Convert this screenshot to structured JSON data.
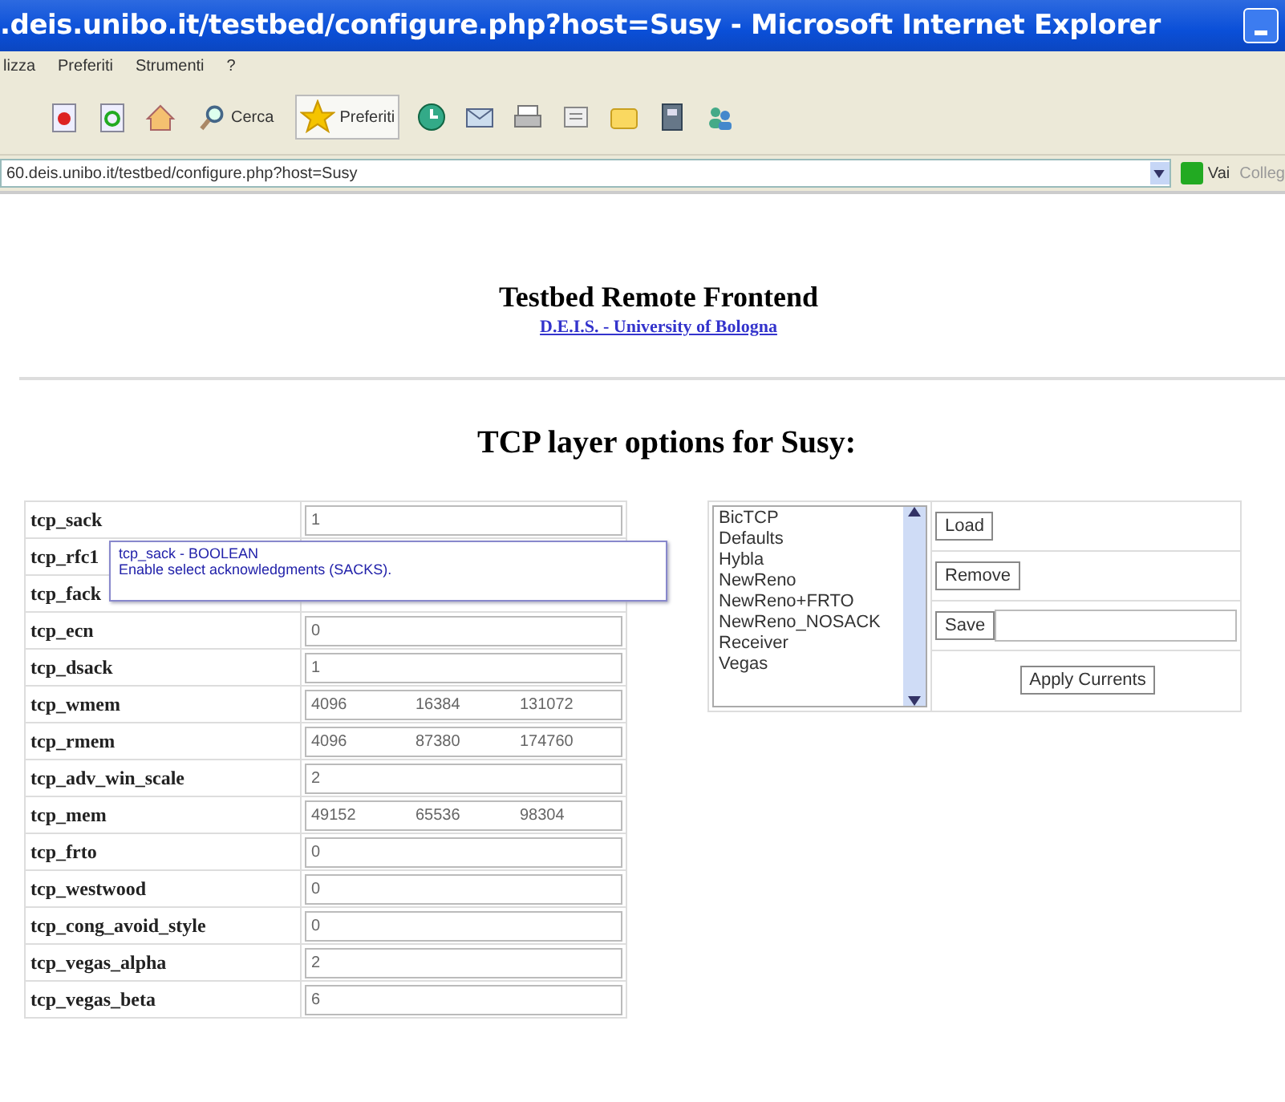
{
  "window": {
    "title": ".deis.unibo.it/testbed/configure.php?host=Susy - Microsoft Internet Explorer"
  },
  "menu": [
    "lizza",
    "Preferiti",
    "Strumenti",
    "?"
  ],
  "toolbar": {
    "search": "Cerca",
    "favorites": "Preferiti"
  },
  "address": {
    "value": "60.deis.unibo.it/testbed/configure.php?host=Susy",
    "go": "Vai",
    "links": "Colleg"
  },
  "page": {
    "heading": "Testbed Remote Frontend",
    "link": "D.E.I.S. - University of Bologna",
    "subheading": "TCP layer options for Susy:"
  },
  "params": [
    {
      "name": "tcp_sack",
      "values": [
        "1"
      ]
    },
    {
      "name": "tcp_rfc1"
    },
    {
      "name": "tcp_fack"
    },
    {
      "name": "tcp_ecn",
      "values": [
        "0"
      ]
    },
    {
      "name": "tcp_dsack",
      "values": [
        "1"
      ]
    },
    {
      "name": "tcp_wmem",
      "values": [
        "4096",
        "16384",
        "131072"
      ]
    },
    {
      "name": "tcp_rmem",
      "values": [
        "4096",
        "87380",
        "174760"
      ]
    },
    {
      "name": "tcp_adv_win_scale",
      "values": [
        "2"
      ]
    },
    {
      "name": "tcp_mem",
      "values": [
        "49152",
        "65536",
        "98304"
      ]
    },
    {
      "name": "tcp_frto",
      "values": [
        "0"
      ]
    },
    {
      "name": "tcp_westwood",
      "values": [
        "0"
      ]
    },
    {
      "name": "tcp_cong_avoid_style",
      "values": [
        "0"
      ]
    },
    {
      "name": "tcp_vegas_alpha",
      "values": [
        "2"
      ]
    },
    {
      "name": "tcp_vegas_beta",
      "values": [
        "6"
      ]
    }
  ],
  "tooltip": {
    "title": "tcp_sack - BOOLEAN",
    "text": "Enable select acknowledgments (SACKS)."
  },
  "profiles": {
    "items": [
      "BicTCP",
      "Defaults",
      "Hybla",
      "NewReno",
      "NewReno+FRTO",
      "NewReno_NOSACK",
      "Receiver",
      "Vegas"
    ],
    "load": "Load",
    "remove": "Remove",
    "save": "Save",
    "apply": "Apply Currents"
  }
}
